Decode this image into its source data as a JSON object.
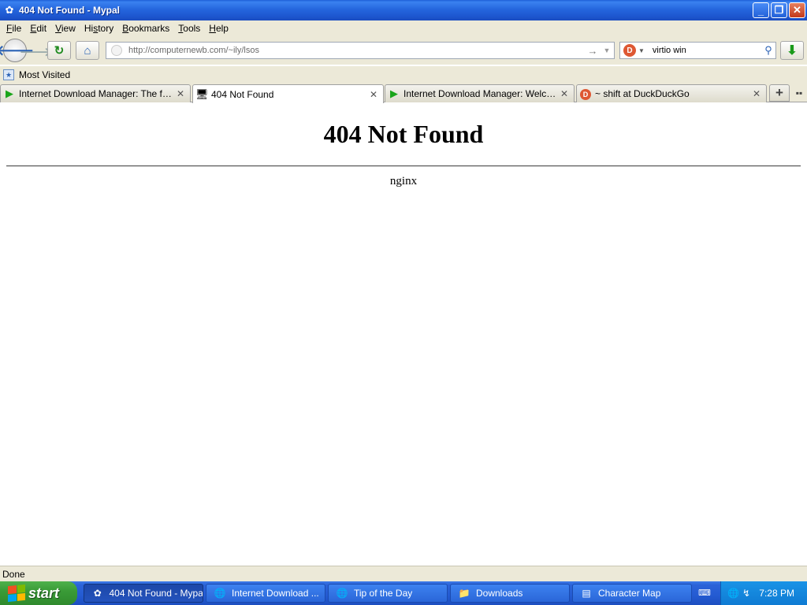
{
  "window": {
    "title": "404 Not Found - Mypal"
  },
  "menu": {
    "items": [
      {
        "key": "F",
        "rest": "ile"
      },
      {
        "key": "E",
        "rest": "dit"
      },
      {
        "key": "V",
        "rest": "iew"
      },
      {
        "key": "",
        "pre": "Hi",
        "keymid": "s",
        "rest": "tory"
      },
      {
        "key": "B",
        "rest": "ookmarks"
      },
      {
        "key": "T",
        "rest": "ools"
      },
      {
        "key": "H",
        "rest": "elp"
      }
    ]
  },
  "nav": {
    "url": "http://computernewb.com/~ily/lsos",
    "search_value": "virtio win"
  },
  "bookmarks": {
    "most_visited": "Most Visited"
  },
  "tabs": [
    {
      "label": "Internet Download Manager: The fastest...",
      "icon": "play-icon"
    },
    {
      "label": "404 Not Found",
      "icon": "page-icon"
    },
    {
      "label": "Internet Download Manager: Welcome t...",
      "icon": "play-icon"
    },
    {
      "label": "~ shift at DuckDuckGo",
      "icon": "duckduckgo-icon"
    }
  ],
  "page": {
    "heading": "404 Not Found",
    "server": "nginx"
  },
  "status": {
    "text": "Done"
  },
  "taskbar": {
    "start": "start",
    "tasks": [
      {
        "label": "404 Not Found - Mypal"
      },
      {
        "label": "Internet Download ..."
      },
      {
        "label": "Tip of the Day"
      },
      {
        "label": "Downloads"
      },
      {
        "label": "Character Map"
      }
    ],
    "clock": "7:28 PM"
  },
  "colors": {
    "titlebar": "#2566de",
    "chrome": "#ece9d8",
    "start_green": "#3a9b37",
    "tray_blue": "#0f7bd3"
  }
}
